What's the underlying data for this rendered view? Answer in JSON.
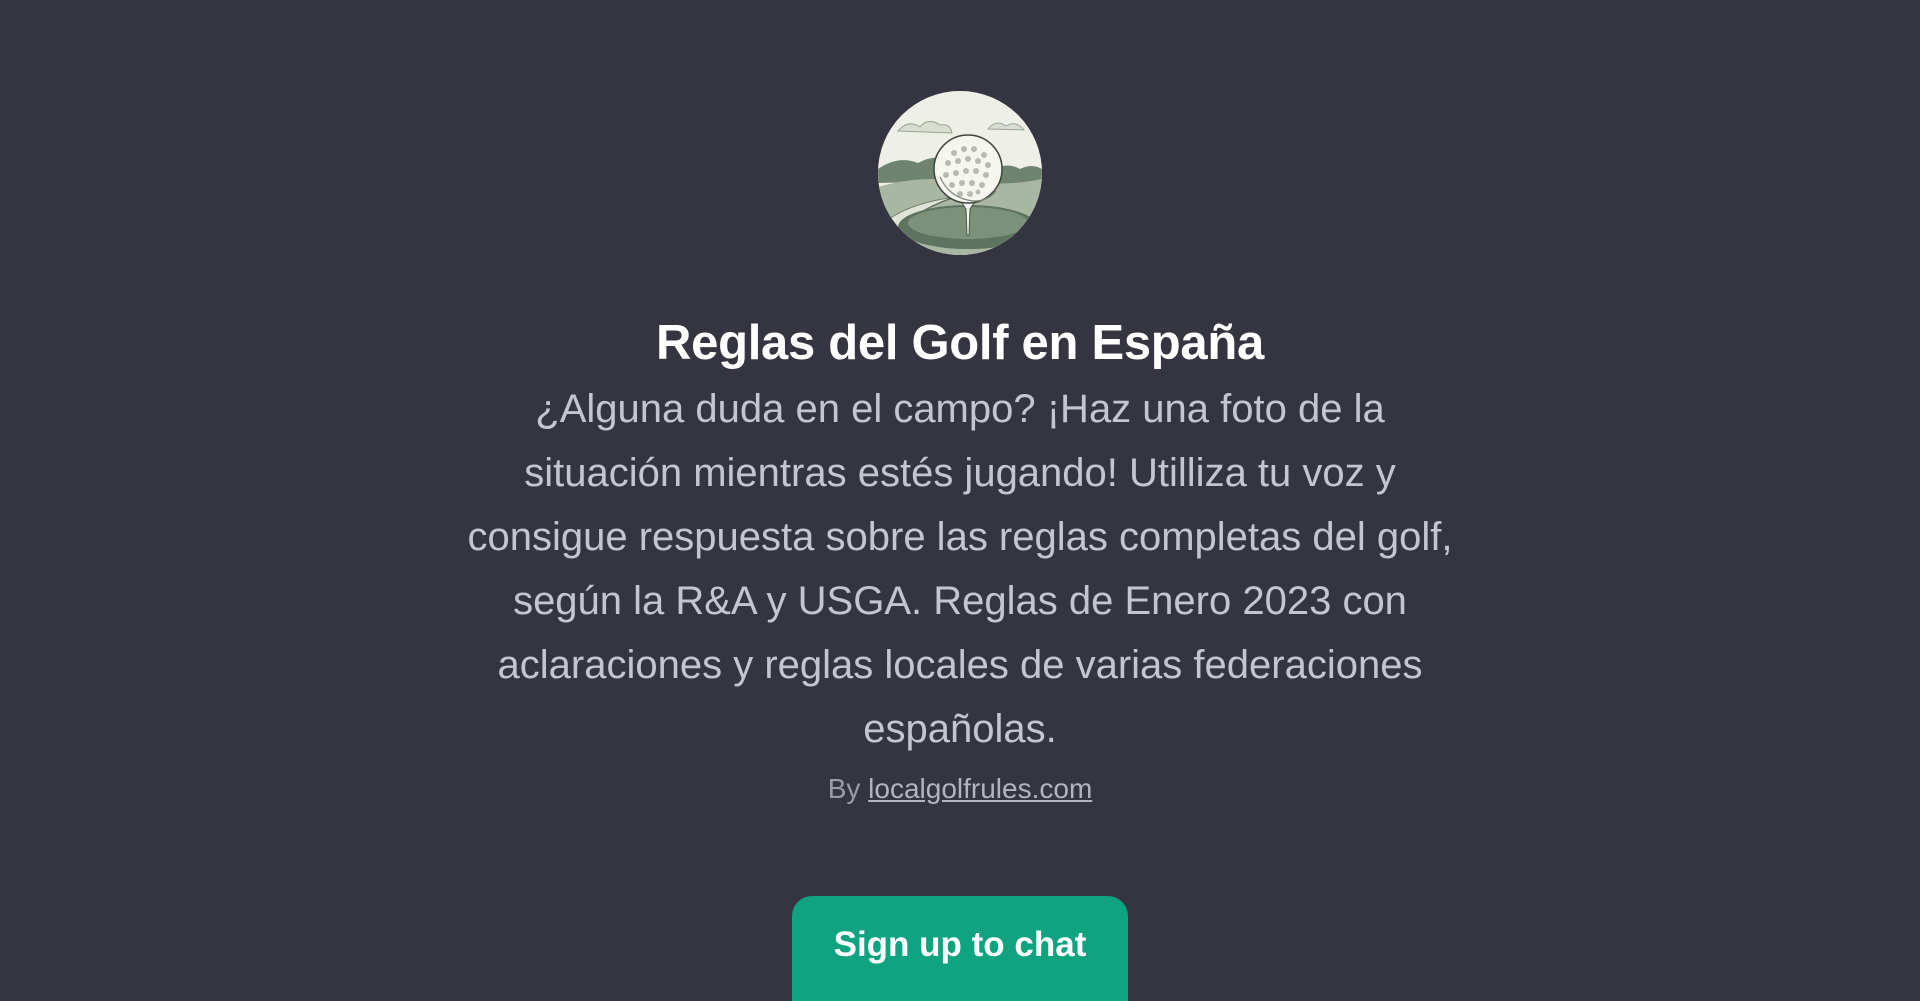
{
  "gpt": {
    "avatar_icon": "golf-ball-on-tee-icon",
    "title": "Reglas del Golf en España",
    "description": "¿Alguna duda en el campo? ¡Haz una foto de la situación mientras estés jugando! Utilliza tu voz y consigue respuesta sobre las reglas completas del golf, según la R&A y USGA. Reglas de Enero 2023 con aclaraciones y reglas locales de varias federaciones españolas.",
    "by_prefix": "By",
    "author_link": "localgolfrules.com"
  },
  "actions": {
    "signup_label": "Sign up to chat"
  },
  "colors": {
    "background": "#343541",
    "accent": "#10a37f",
    "title": "#ffffff",
    "description": "#c5c5d2"
  }
}
